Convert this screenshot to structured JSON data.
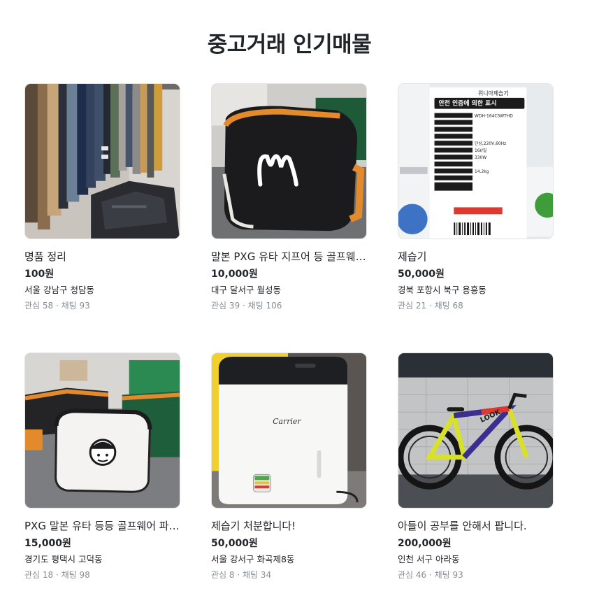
{
  "page": {
    "title": "중고거래 인기매물"
  },
  "articles": [
    {
      "title": "명품 정리",
      "price": "100원",
      "region": "서울 강남구 청담동",
      "counts": "관심 58 · 채팅 93",
      "image": "clothes-rack-photo"
    },
    {
      "title": "말본 PXG 유타 지프어 등 골프웨어 파우치",
      "price": "10,000원",
      "region": "대구 달서구 월성동",
      "counts": "관심 39 · 채팅 106",
      "image": "pouch-photo"
    },
    {
      "title": "제습기",
      "price": "50,000원",
      "region": "경북 포항시 북구 용흥동",
      "counts": "관심 21 · 채팅 68",
      "image": "dehumidifier-label-photo"
    },
    {
      "title": "PXG 말본 유타 등등 골프웨어 파우치",
      "price": "15,000원",
      "region": "경기도 평택시 고덕동",
      "counts": "관심 18 · 채팅 98",
      "image": "golf-pouches-photo"
    },
    {
      "title": "제습기 처분합니다!",
      "price": "50,000원",
      "region": "서울 강서구 화곡제8동",
      "counts": "관심 8 · 채팅 34",
      "image": "carrier-dehumidifier-photo"
    },
    {
      "title": "아들이 공부를 안해서 팝니다.",
      "price": "200,000원",
      "region": "인천 서구 아라동",
      "counts": "관심 46 · 채팅 93",
      "image": "road-bike-photo"
    }
  ],
  "image_texts": {
    "pouch_logo": "malbon",
    "label_brand": "위니아제습기",
    "label_heading": "안전 인증에 의한 표시",
    "label_model": "WDH-164CSWTHD",
    "label_voltage": "단상,220V,60Hz",
    "label_capacity": "16ℓ/일",
    "label_power": "330W",
    "label_weight": "14.2kg",
    "carrier_logo": "Carrier",
    "bike_logo": "LOOK"
  }
}
